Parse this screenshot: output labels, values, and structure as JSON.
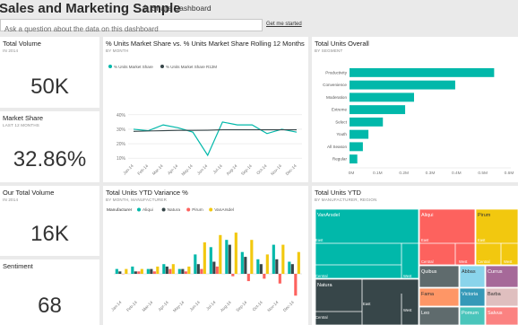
{
  "dashboard": {
    "title": "Sales and Marketing Sample",
    "share_label": "Share Dashboard"
  },
  "qa": {
    "placeholder": "Ask a question about the data on this dashboard",
    "get_started": "Get me started"
  },
  "tiles": {
    "total_volume": {
      "title": "Total Volume",
      "subtitle": "IN 2014",
      "value": "50K"
    },
    "market_share": {
      "title": "Market Share",
      "subtitle": "LAST 12 MONTHS",
      "value": "32.86%"
    },
    "our_total_volume": {
      "title": "Our Total Volume",
      "subtitle": "IN 2014",
      "value": "16K"
    },
    "sentiment": {
      "title": "Sentiment",
      "value": "68"
    },
    "market_share_chart": {
      "title": "% Units Market Share vs. % Units Market Share Rolling 12 Months",
      "subtitle": "BY MONTH"
    },
    "total_units_overall": {
      "title": "Total Units Overall",
      "subtitle": "BY SEGMENT"
    },
    "ytd_variance": {
      "title": "Total Units YTD Variance %",
      "subtitle": "BY MONTH, MANUFACTURER"
    },
    "total_units_ytd": {
      "title": "Total Units YTD",
      "subtitle": "BY MANUFACTURER, REGION"
    }
  },
  "colors": {
    "teal": "#01b8aa",
    "dark": "#374649",
    "red": "#fd625e",
    "yellow": "#f2c80f",
    "grey": "#5f6b6d"
  },
  "chart_data": [
    {
      "id": "market_share_line",
      "type": "line",
      "x": [
        "Jan-14",
        "Feb-14",
        "Mar-14",
        "Apr-14",
        "May-14",
        "Jun-14",
        "Jul-14",
        "Aug-14",
        "Sep-14",
        "Oct-14",
        "Nov-14",
        "Dec-14"
      ],
      "series": [
        {
          "name": "% Units Market Share",
          "values": [
            30,
            29,
            33,
            31,
            28,
            12,
            35,
            33,
            33,
            27,
            30,
            28
          ]
        },
        {
          "name": "% Units Market Share R12M",
          "values": [
            28.5,
            28.8,
            29,
            29.2,
            29.2,
            29.3,
            29.6,
            29.6,
            29.6,
            29.6,
            29.6,
            29.6
          ]
        }
      ],
      "yticks": [
        "40%",
        "30%",
        "20%",
        "10%"
      ],
      "ylim": [
        7,
        43
      ]
    },
    {
      "id": "segment_bar",
      "type": "bar",
      "orientation": "horizontal",
      "categories": [
        "Productivity",
        "Convenience",
        "Moderation",
        "Extreme",
        "Select",
        "Youth",
        "All Season",
        "Regular"
      ],
      "values": [
        1.3,
        0.95,
        0.58,
        0.5,
        0.3,
        0.17,
        0.12,
        0.07
      ],
      "xticks": [
        "0M",
        "0.1M",
        "0.2M",
        "0.3M",
        "0.4M",
        "0.5M",
        "0.6M"
      ],
      "xlim": [
        0,
        1.45
      ]
    },
    {
      "id": "ytd_variance_bars",
      "type": "bar",
      "legend_title": "Manufacturer",
      "categories": [
        "Jan-14",
        "Feb-14",
        "Mar-14",
        "Apr-14",
        "May-14",
        "Jun-14",
        "Jul-14",
        "Aug-14",
        "Sep-14",
        "Oct-14",
        "Nov-14",
        "Dec-14"
      ],
      "series": [
        {
          "name": "Aliqui",
          "values": [
            2,
            3,
            2,
            4,
            2,
            8,
            11,
            14,
            9,
            6,
            12,
            5
          ]
        },
        {
          "name": "Natura",
          "values": [
            1,
            1,
            2,
            3,
            2,
            4,
            5,
            12,
            7,
            4,
            6,
            4
          ]
        },
        {
          "name": "Pirum",
          "values": [
            0,
            1,
            1,
            2,
            1,
            2,
            3,
            -1,
            -3,
            -2,
            -4,
            -9
          ]
        },
        {
          "name": "VanArsdel",
          "values": [
            2,
            2,
            3,
            4,
            3,
            13,
            16,
            17,
            14,
            8,
            12,
            9
          ]
        }
      ],
      "ylim": [
        -10,
        20
      ]
    },
    {
      "id": "units_ytd_treemap",
      "type": "treemap",
      "nodes": [
        {
          "label": "VanArsdel",
          "regions": [
            "East",
            "Central",
            "West"
          ]
        },
        {
          "label": "Natura",
          "regions": [
            "Central",
            "East",
            "West"
          ]
        },
        {
          "label": "Aliqui",
          "regions": [
            "East",
            "Central",
            "West"
          ]
        },
        {
          "label": "Pirum",
          "regions": [
            "East",
            "Central",
            "West"
          ]
        },
        {
          "label": "Quibus",
          "regions": []
        },
        {
          "label": "Abbas",
          "regions": []
        },
        {
          "label": "Currus",
          "regions": []
        },
        {
          "label": "Fama",
          "regions": []
        },
        {
          "label": "Victoria",
          "regions": []
        },
        {
          "label": "Barba",
          "regions": []
        },
        {
          "label": "Pomum",
          "regions": []
        },
        {
          "label": "Leo",
          "regions": []
        },
        {
          "label": "Salvus",
          "regions": []
        }
      ]
    }
  ]
}
